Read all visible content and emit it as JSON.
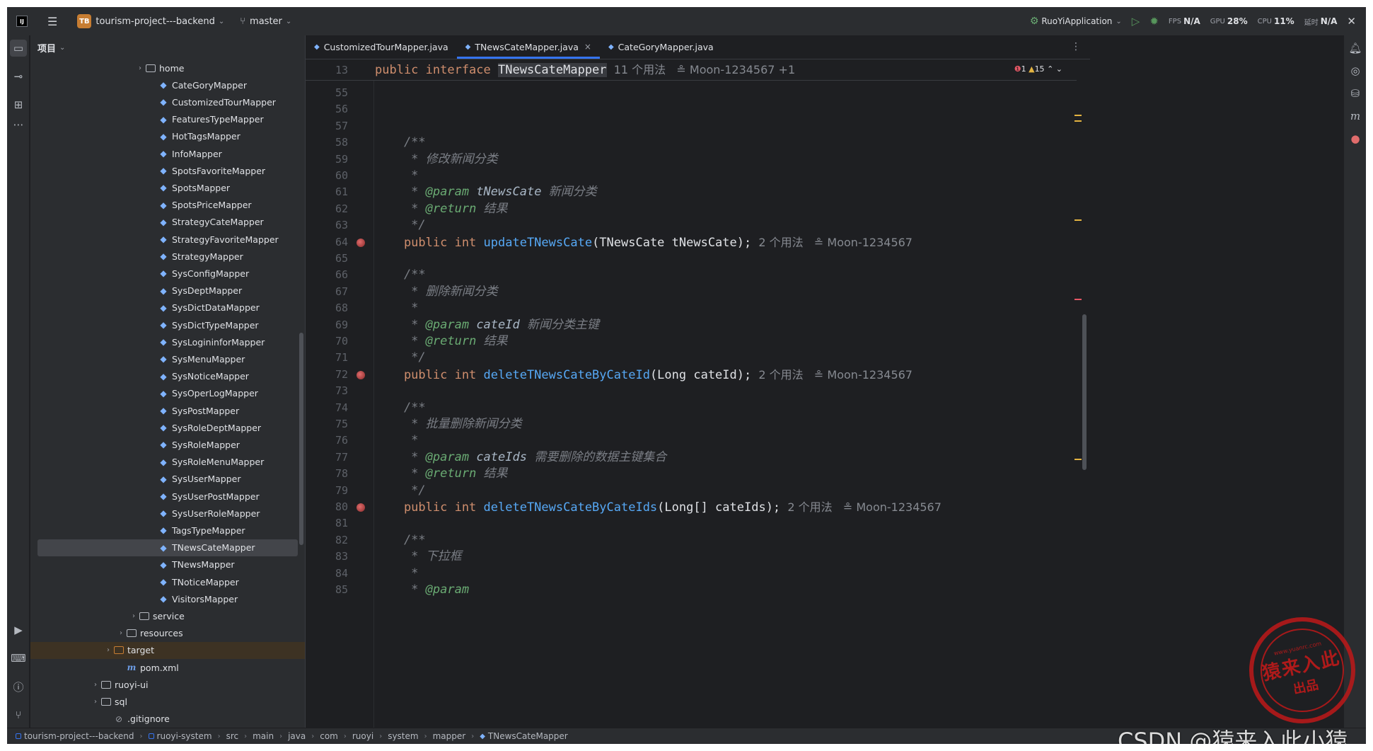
{
  "titlebar": {
    "project_badge": "TB",
    "project_name": "tourism-project---backend",
    "branch": "master",
    "run_config": "RuoYiApplication",
    "meters": [
      {
        "label": "FPS",
        "value": "N/A"
      },
      {
        "label": "GPU",
        "value": "28%"
      },
      {
        "label": "CPU",
        "value": "11%"
      },
      {
        "label": "延时",
        "value": "N/A"
      }
    ]
  },
  "project_panel": {
    "title": "项目",
    "rows": [
      {
        "name": "home",
        "kind": "folder",
        "indent": 1,
        "arrow": "›"
      },
      {
        "name": "CateGoryMapper",
        "kind": "iface",
        "indent": 2
      },
      {
        "name": "CustomizedTourMapper",
        "kind": "iface",
        "indent": 2
      },
      {
        "name": "FeaturesTypeMapper",
        "kind": "iface",
        "indent": 2
      },
      {
        "name": "HotTagsMapper",
        "kind": "iface",
        "indent": 2
      },
      {
        "name": "InfoMapper",
        "kind": "iface",
        "indent": 2
      },
      {
        "name": "SpotsFavoriteMapper",
        "kind": "iface",
        "indent": 2
      },
      {
        "name": "SpotsMapper",
        "kind": "iface",
        "indent": 2
      },
      {
        "name": "SpotsPriceMapper",
        "kind": "iface",
        "indent": 2
      },
      {
        "name": "StrategyCateMapper",
        "kind": "iface",
        "indent": 2
      },
      {
        "name": "StrategyFavoriteMapper",
        "kind": "iface",
        "indent": 2
      },
      {
        "name": "StrategyMapper",
        "kind": "iface",
        "indent": 2
      },
      {
        "name": "SysConfigMapper",
        "kind": "iface",
        "indent": 2
      },
      {
        "name": "SysDeptMapper",
        "kind": "iface",
        "indent": 2
      },
      {
        "name": "SysDictDataMapper",
        "kind": "iface",
        "indent": 2
      },
      {
        "name": "SysDictTypeMapper",
        "kind": "iface",
        "indent": 2
      },
      {
        "name": "SysLogininforMapper",
        "kind": "iface",
        "indent": 2
      },
      {
        "name": "SysMenuMapper",
        "kind": "iface",
        "indent": 2
      },
      {
        "name": "SysNoticeMapper",
        "kind": "iface",
        "indent": 2
      },
      {
        "name": "SysOperLogMapper",
        "kind": "iface",
        "indent": 2
      },
      {
        "name": "SysPostMapper",
        "kind": "iface",
        "indent": 2
      },
      {
        "name": "SysRoleDeptMapper",
        "kind": "iface",
        "indent": 2
      },
      {
        "name": "SysRoleMapper",
        "kind": "iface",
        "indent": 2
      },
      {
        "name": "SysRoleMenuMapper",
        "kind": "iface",
        "indent": 2
      },
      {
        "name": "SysUserMapper",
        "kind": "iface",
        "indent": 2
      },
      {
        "name": "SysUserPostMapper",
        "kind": "iface",
        "indent": 2
      },
      {
        "name": "SysUserRoleMapper",
        "kind": "iface",
        "indent": 2
      },
      {
        "name": "TagsTypeMapper",
        "kind": "iface",
        "indent": 2
      },
      {
        "name": "TNewsCateMapper",
        "kind": "iface",
        "indent": 2,
        "selected": true
      },
      {
        "name": "TNewsMapper",
        "kind": "iface",
        "indent": 2
      },
      {
        "name": "TNoticeMapper",
        "kind": "iface",
        "indent": 2
      },
      {
        "name": "VisitorsMapper",
        "kind": "iface",
        "indent": 2
      },
      {
        "name": "service",
        "kind": "folder",
        "indent": 0.5,
        "arrow": "›"
      },
      {
        "name": "resources",
        "kind": "folder",
        "indent": -0.5,
        "arrow": "›"
      },
      {
        "name": "target",
        "kind": "folder-orange",
        "indent": -1.5,
        "arrow": "›",
        "target": true
      },
      {
        "name": "pom.xml",
        "kind": "maven",
        "indent": -0.5
      },
      {
        "name": "ruoyi-ui",
        "kind": "folder",
        "indent": -2.5,
        "arrow": "›"
      },
      {
        "name": "sql",
        "kind": "folder",
        "indent": -2.5,
        "arrow": "›"
      },
      {
        "name": ".gitignore",
        "kind": "file",
        "indent": -1.5
      }
    ]
  },
  "editor": {
    "tabs": [
      {
        "label": "CustomizedTourMapper.java",
        "active": false
      },
      {
        "label": "TNewsCateMapper.java",
        "active": true,
        "closable": true
      },
      {
        "label": "CateGoryMapper.java",
        "active": false
      }
    ],
    "inspections": {
      "errors": "1",
      "warnings": "15"
    },
    "sticky": {
      "line": "13",
      "kw": "public interface ",
      "name": "TNewsCateMapper",
      "usages": "11 个用法",
      "author": "Moon-1234567 +1"
    },
    "lines": [
      {
        "n": "55",
        "segs": []
      },
      {
        "n": "56",
        "segs": []
      },
      {
        "n": "57",
        "segs": []
      },
      {
        "n": "58",
        "segs": [
          {
            "c": "cm",
            "t": "    /**"
          }
        ]
      },
      {
        "n": "59",
        "segs": [
          {
            "c": "cm",
            "t": "     * 修改新闻分类"
          }
        ]
      },
      {
        "n": "60",
        "segs": [
          {
            "c": "cm",
            "t": "     *"
          }
        ]
      },
      {
        "n": "61",
        "segs": [
          {
            "c": "cm",
            "t": "     * "
          },
          {
            "c": "tag",
            "t": "@param"
          },
          {
            "c": "pn",
            "t": " tNewsCate"
          },
          {
            "c": "cm",
            "t": " 新闻分类"
          }
        ]
      },
      {
        "n": "62",
        "segs": [
          {
            "c": "cm",
            "t": "     * "
          },
          {
            "c": "tag",
            "t": "@return"
          },
          {
            "c": "cm",
            "t": " 结果"
          }
        ]
      },
      {
        "n": "63",
        "segs": [
          {
            "c": "cm",
            "t": "     */"
          }
        ]
      },
      {
        "n": "64",
        "bp": true,
        "segs": [
          {
            "c": "kw",
            "t": "    public int "
          },
          {
            "c": "fn",
            "t": "updateTNewsCate"
          },
          {
            "c": "",
            "t": "(TNewsCate tNewsCate);"
          },
          {
            "c": "hint",
            "t": "  2 个用法   ≗ Moon-1234567"
          }
        ]
      },
      {
        "n": "65",
        "segs": []
      },
      {
        "n": "66",
        "segs": [
          {
            "c": "cm",
            "t": "    /**"
          }
        ]
      },
      {
        "n": "67",
        "segs": [
          {
            "c": "cm",
            "t": "     * 删除新闻分类"
          }
        ]
      },
      {
        "n": "68",
        "segs": [
          {
            "c": "cm",
            "t": "     *"
          }
        ]
      },
      {
        "n": "69",
        "segs": [
          {
            "c": "cm",
            "t": "     * "
          },
          {
            "c": "tag",
            "t": "@param"
          },
          {
            "c": "pn",
            "t": " cateId"
          },
          {
            "c": "cm",
            "t": " 新闻分类主键"
          }
        ]
      },
      {
        "n": "70",
        "segs": [
          {
            "c": "cm",
            "t": "     * "
          },
          {
            "c": "tag",
            "t": "@return"
          },
          {
            "c": "cm",
            "t": " 结果"
          }
        ]
      },
      {
        "n": "71",
        "segs": [
          {
            "c": "cm",
            "t": "     */"
          }
        ]
      },
      {
        "n": "72",
        "bp": true,
        "segs": [
          {
            "c": "kw",
            "t": "    public int "
          },
          {
            "c": "fn",
            "t": "deleteTNewsCateByCateId"
          },
          {
            "c": "",
            "t": "(Long cateId);"
          },
          {
            "c": "hint",
            "t": "  2 个用法   ≗ Moon-1234567"
          }
        ]
      },
      {
        "n": "73",
        "segs": []
      },
      {
        "n": "74",
        "segs": [
          {
            "c": "cm",
            "t": "    /**"
          }
        ]
      },
      {
        "n": "75",
        "segs": [
          {
            "c": "cm",
            "t": "     * 批量删除新闻分类"
          }
        ]
      },
      {
        "n": "76",
        "segs": [
          {
            "c": "cm",
            "t": "     *"
          }
        ]
      },
      {
        "n": "77",
        "segs": [
          {
            "c": "cm",
            "t": "     * "
          },
          {
            "c": "tag",
            "t": "@param"
          },
          {
            "c": "pn",
            "t": " cateIds"
          },
          {
            "c": "cm",
            "t": " 需要删除的数据主键集合"
          }
        ]
      },
      {
        "n": "78",
        "segs": [
          {
            "c": "cm",
            "t": "     * "
          },
          {
            "c": "tag",
            "t": "@return"
          },
          {
            "c": "cm",
            "t": " 结果"
          }
        ]
      },
      {
        "n": "79",
        "segs": [
          {
            "c": "cm",
            "t": "     */"
          }
        ]
      },
      {
        "n": "80",
        "bp": true,
        "segs": [
          {
            "c": "kw",
            "t": "    public int "
          },
          {
            "c": "fn",
            "t": "deleteTNewsCateByCateIds"
          },
          {
            "c": "",
            "t": "(Long[] cateIds);"
          },
          {
            "c": "hint",
            "t": "  2 个用法   ≗ Moon-1234567"
          }
        ]
      },
      {
        "n": "81",
        "segs": []
      },
      {
        "n": "82",
        "segs": [
          {
            "c": "cm",
            "t": "    /**"
          }
        ]
      },
      {
        "n": "83",
        "segs": [
          {
            "c": "cm",
            "t": "     * 下拉框"
          }
        ]
      },
      {
        "n": "84",
        "segs": [
          {
            "c": "cm",
            "t": "     *"
          }
        ]
      },
      {
        "n": "85",
        "segs": [
          {
            "c": "cm",
            "t": "     * "
          },
          {
            "c": "tag",
            "t": "@param"
          }
        ]
      }
    ]
  },
  "statusbar": {
    "crumbs": [
      "tourism-project---backend",
      "ruoyi-system",
      "src",
      "main",
      "java",
      "com",
      "ruoyi",
      "system",
      "mapper",
      "TNewsCateMapper"
    ]
  },
  "watermark": {
    "stamp_main": "猿来入此",
    "stamp_sub": "出品",
    "stamp_url": "www.yuanrc.com",
    "text": "CSDN @猿来入此小猿"
  },
  "colors": {
    "accent": "#3574f0",
    "keyword": "#cf8e6d",
    "function": "#56a8f5",
    "comment": "#7a7e85",
    "doc_tag": "#6aab73"
  }
}
